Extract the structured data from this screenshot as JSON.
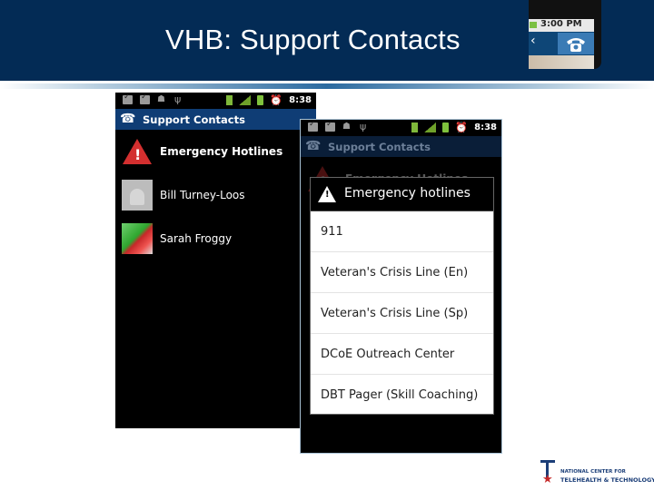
{
  "slide": {
    "title": "VHB: Support Contacts"
  },
  "thumbnail": {
    "time": "3:00 PM",
    "back_glyph": "‹",
    "icon": "phone-icon"
  },
  "phone1": {
    "status_time": "8:38",
    "action_bar_title": "Support Contacts",
    "contacts": [
      {
        "label": "Emergency Hotlines",
        "icon": "warning-icon"
      },
      {
        "label": "Bill Turney-Loos",
        "icon": "android-avatar"
      },
      {
        "label": "Sarah Froggy",
        "icon": "frog-avatar"
      }
    ]
  },
  "phone2": {
    "status_time": "8:38",
    "action_bar_title": "Support Contacts",
    "background_item": "Emergency Hotlines",
    "dialog": {
      "title": "Emergency hotlines",
      "items": [
        "911",
        "Veteran's Crisis Line (En)",
        "Veteran's Crisis Line (Sp)",
        "DCoE Outreach Center",
        "DBT Pager (Skill Coaching)"
      ]
    }
  },
  "logo": {
    "line1": "NATIONAL CENTER FOR",
    "line2": "TELEHEALTH & TECHNOLOGY"
  },
  "colors": {
    "header_bg": "#032b55",
    "action_bar": "#0f3d75",
    "warning_red": "#d32f2f"
  }
}
